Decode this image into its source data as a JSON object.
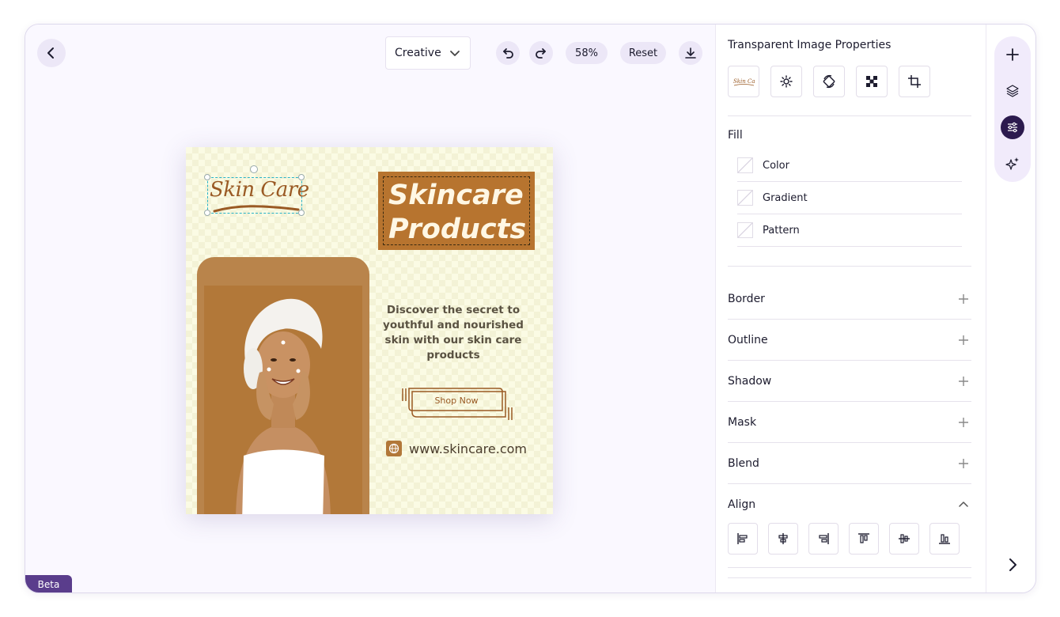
{
  "toolbar": {
    "back_icon": "chevron-left-icon",
    "mode_select": "Creative",
    "zoom": "58%",
    "reset_label": "Reset"
  },
  "beta_label": "Beta",
  "design": {
    "logo_text": "Skin Care",
    "title_line1": "Skincare",
    "title_line2": "Products",
    "tagline": "Discover the secret to youthful and nourished skin with our skin care products",
    "shop_label": "Shop Now",
    "website": "www.skincare.com",
    "colors": {
      "background": "#fbfbe4",
      "brand": "#b7742f",
      "text": "#5a5242"
    }
  },
  "properties": {
    "title": "Transparent Image Properties",
    "fill_label": "Fill",
    "fill_options": [
      "Color",
      "Gradient",
      "Pattern"
    ],
    "sections": [
      "Border",
      "Outline",
      "Shadow",
      "Mask",
      "Blend"
    ],
    "align_label": "Align"
  },
  "rail": {
    "icons": [
      "plus-icon",
      "layers-icon",
      "sliders-icon",
      "sparkle-icon"
    ],
    "active": "sliders-icon"
  }
}
